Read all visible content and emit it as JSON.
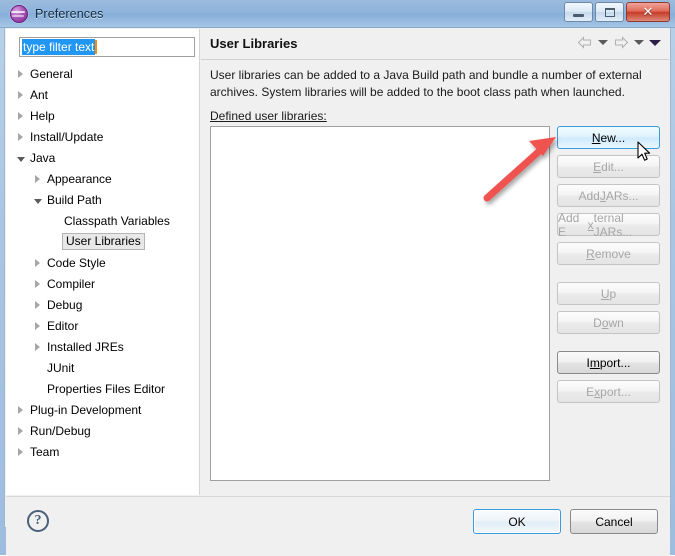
{
  "window": {
    "title": "Preferences",
    "icon": "eclipse-sphere-icon",
    "controls": {
      "minimize": "minimize-button",
      "maximize": "restore-button",
      "close_glyph": "✕"
    }
  },
  "filter": {
    "value": "type filter text",
    "placeholder": "type filter text"
  },
  "tree": {
    "items": [
      {
        "label": "General",
        "indent": 0,
        "state": "collapsed"
      },
      {
        "label": "Ant",
        "indent": 0,
        "state": "collapsed"
      },
      {
        "label": "Help",
        "indent": 0,
        "state": "collapsed"
      },
      {
        "label": "Install/Update",
        "indent": 0,
        "state": "collapsed"
      },
      {
        "label": "Java",
        "indent": 0,
        "state": "expanded"
      },
      {
        "label": "Appearance",
        "indent": 1,
        "state": "collapsed"
      },
      {
        "label": "Build Path",
        "indent": 1,
        "state": "expanded"
      },
      {
        "label": "Classpath Variables",
        "indent": 2,
        "state": "leaf"
      },
      {
        "label": "User Libraries",
        "indent": 2,
        "state": "leaf",
        "selected": true
      },
      {
        "label": "Code Style",
        "indent": 1,
        "state": "collapsed"
      },
      {
        "label": "Compiler",
        "indent": 1,
        "state": "collapsed"
      },
      {
        "label": "Debug",
        "indent": 1,
        "state": "collapsed"
      },
      {
        "label": "Editor",
        "indent": 1,
        "state": "collapsed"
      },
      {
        "label": "Installed JREs",
        "indent": 1,
        "state": "collapsed"
      },
      {
        "label": "JUnit",
        "indent": 1,
        "state": "leaf"
      },
      {
        "label": "Properties Files Editor",
        "indent": 1,
        "state": "leaf"
      },
      {
        "label": "Plug-in Development",
        "indent": 0,
        "state": "collapsed"
      },
      {
        "label": "Run/Debug",
        "indent": 0,
        "state": "collapsed"
      },
      {
        "label": "Team",
        "indent": 0,
        "state": "collapsed"
      }
    ]
  },
  "pane": {
    "title": "User Libraries",
    "description_line1": "User libraries can be added to a Java Build path and bundle a number of external",
    "description_line2": "archives. System libraries will be added to the boot class path when launched.",
    "list_label_mnemonic": "D",
    "list_label_rest": "efined user libraries:",
    "list_items": [],
    "nav": {
      "back": "back-arrow-icon",
      "back_menu": "chevron-down-icon",
      "forward": "forward-arrow-icon",
      "forward_menu": "chevron-down-icon",
      "view_menu": "chevron-down-icon"
    }
  },
  "side_buttons": [
    {
      "mnemonic": "N",
      "pre": "",
      "post": "ew...",
      "state": "hover"
    },
    {
      "mnemonic": "E",
      "pre": "",
      "post": "dit...",
      "state": "disabled"
    },
    {
      "mnemonic": "J",
      "pre": "Add ",
      "post": "ARs...",
      "state": "disabled"
    },
    {
      "mnemonic": "x",
      "pre": "Add E",
      "post": "ternal JARs...",
      "state": "disabled"
    },
    {
      "mnemonic": "R",
      "pre": "",
      "post": "emove",
      "state": "disabled"
    },
    {
      "mnemonic": "U",
      "pre": "",
      "post": "p",
      "state": "disabled",
      "gap_before": true
    },
    {
      "mnemonic": "o",
      "pre": "D",
      "post": "wn",
      "state": "disabled"
    },
    {
      "mnemonic": "m",
      "pre": "I",
      "post": "port...",
      "state": "enabled",
      "gap_before": true
    },
    {
      "mnemonic": "x",
      "pre": "E",
      "post": "port...",
      "state": "disabled"
    }
  ],
  "footer": {
    "help": "?",
    "ok": "OK",
    "cancel": "Cancel"
  },
  "annotation": {
    "arrow": "red-arrow-annotation",
    "arrow_color": "#ef5350",
    "cursor": "mouse-pointer"
  }
}
